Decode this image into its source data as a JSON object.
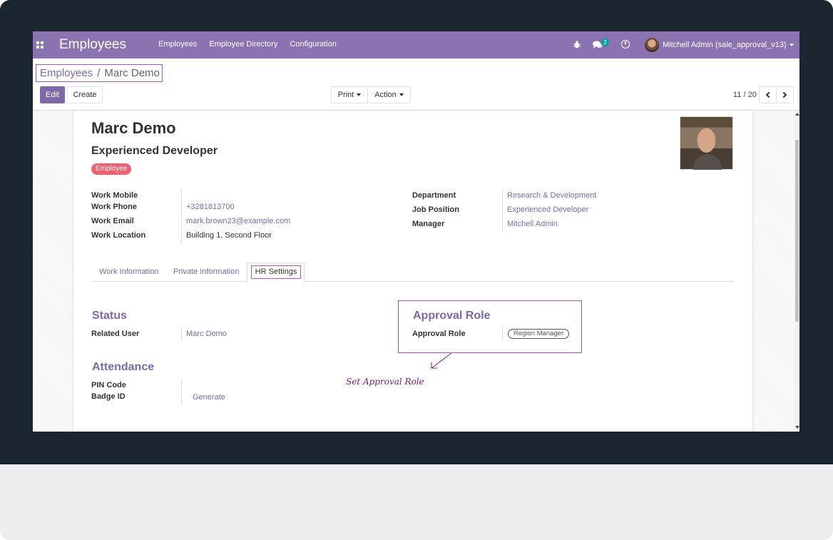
{
  "navbar": {
    "brand": "Employees",
    "menu": [
      "Employees",
      "Employee Directory",
      "Configuration"
    ],
    "message_count": "2",
    "user": "Mitchell Admin (sale_approval_v13)"
  },
  "breadcrumb": {
    "parent": "Employees",
    "separator": "/",
    "current": "Marc Demo"
  },
  "buttons": {
    "edit": "Edit",
    "create": "Create",
    "print": "Print",
    "action": "Action"
  },
  "pager": {
    "text": "11 / 20"
  },
  "employee": {
    "name": "Marc Demo",
    "job_title": "Experienced Developer",
    "tag": "Employee"
  },
  "contact": {
    "work_mobile_label": "Work Mobile",
    "work_mobile": "",
    "work_phone_label": "Work Phone",
    "work_phone": "+3281813700",
    "work_email_label": "Work Email",
    "work_email": "mark.brown23@example.com",
    "work_location_label": "Work Location",
    "work_location": "Building 1, Second Floor"
  },
  "org": {
    "department_label": "Department",
    "department": "Research & Development",
    "job_position_label": "Job Position",
    "job_position": "Experienced Developer",
    "manager_label": "Manager",
    "manager": "Mitchell Admin"
  },
  "tabs": [
    "Work Information",
    "Private Information",
    "HR Settings"
  ],
  "status": {
    "title": "Status",
    "related_user_label": "Related User",
    "related_user": "Marc Demo"
  },
  "attendance": {
    "title": "Attendance",
    "pin_label": "PIN Code",
    "badge_label": "Badge ID",
    "generate": "Generate"
  },
  "approval": {
    "title": "Approval Role",
    "role_label": "Approval Role",
    "role_value": "Region Manager"
  },
  "annotation": "Set Approval Role",
  "colors": {
    "navbar": "#8b72b0",
    "accent": "#7c6aa8",
    "highlight": "#a259b0",
    "tag": "#f06070",
    "annotation": "#7b1b73"
  }
}
